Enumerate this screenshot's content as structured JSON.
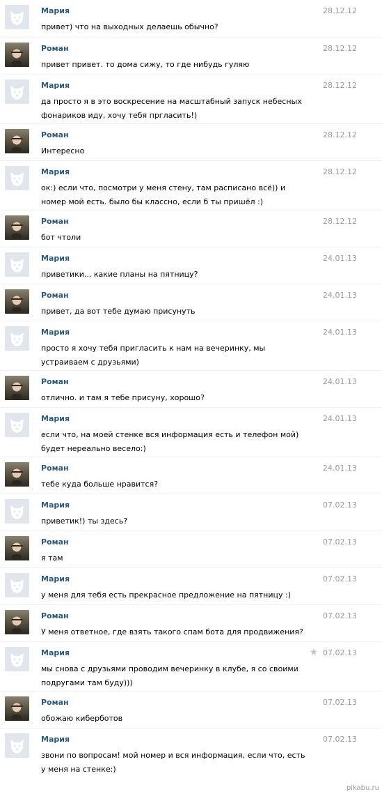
{
  "watermark": "pikabu.ru",
  "colors": {
    "name": "#2b587a",
    "date": "#999999",
    "text": "#000000"
  },
  "messages": [
    {
      "sender": "Мария",
      "avatar": "dog",
      "date": "28.12.12",
      "text": "привет) что на выходных делаешь обычно?"
    },
    {
      "sender": "Роман",
      "avatar": "photo",
      "date": "28.12.12",
      "text": "привет привет. то дома сижу, то где нибудь гуляю"
    },
    {
      "sender": "Мария",
      "avatar": "dog",
      "date": "28.12.12",
      "text": "да просто я в это воскресение на масштабный запуск небесных\nфонариков иду, хочу тебя прглаcить!)"
    },
    {
      "sender": "Роман",
      "avatar": "photo",
      "date": "28.12.12",
      "text": "Интересно"
    },
    {
      "sender": "Мария",
      "avatar": "dog",
      "date": "28.12.12",
      "text": "ок:) если что, посмотри у меня стену, там расписано всё)) и\nномер мой есть. было бы классно, если б ты пришёл :)"
    },
    {
      "sender": "Роман",
      "avatar": "photo",
      "date": "28.12.12",
      "text": "бот чтоли"
    },
    {
      "sender": "Мария",
      "avatar": "dog",
      "date": "24.01.13",
      "text": "приветики... какие планы на пятницу?"
    },
    {
      "sender": "Роман",
      "avatar": "photo",
      "date": "24.01.13",
      "text": "привет, да вот тебе думаю присунуть"
    },
    {
      "sender": "Мария",
      "avatar": "dog",
      "date": "24.01.13",
      "text": "просто я хочу тебя пригласить к нам на вечеринку, мы\nустраиваем с друзьями)"
    },
    {
      "sender": "Роман",
      "avatar": "photo",
      "date": "24.01.13",
      "text": "отлично. и там я тебе присуну, хорошо?"
    },
    {
      "sender": "Мария",
      "avatar": "dog",
      "date": "24.01.13",
      "text": "если что, на моей стенке вся информация есть и телефон мой)\nбудет нереально весело:)"
    },
    {
      "sender": "Роман",
      "avatar": "photo",
      "date": "24.01.13",
      "text": "тебе куда больше нравится?"
    },
    {
      "sender": "Мария",
      "avatar": "dog",
      "date": "07.02.13",
      "text": "приветик!) ты здесь?"
    },
    {
      "sender": "Роман",
      "avatar": "photo",
      "date": "07.02.13",
      "text": "я там"
    },
    {
      "sender": "Мария",
      "avatar": "dog",
      "date": "07.02.13",
      "text": "у меня для тебя есть прекрасное предложение на пятницу :)"
    },
    {
      "sender": "Роман",
      "avatar": "photo",
      "date": "07.02.13",
      "text": "У меня ответное, где взять такого спам бота для продвижения?"
    },
    {
      "sender": "Мария",
      "avatar": "dog",
      "date": "07.02.13",
      "text": "мы снова с друзьями проводим вечеринку в клубе, я со своими\nподругами там буду)))",
      "starred": true
    },
    {
      "sender": "Роман",
      "avatar": "photo",
      "date": "07.02.13",
      "text": "обожаю киберботов"
    },
    {
      "sender": "Мария",
      "avatar": "dog",
      "date": "07.02.13",
      "text": "звони по вопросам! мой номер и вся информация, если что, есть\nу меня на стенке:)"
    }
  ]
}
